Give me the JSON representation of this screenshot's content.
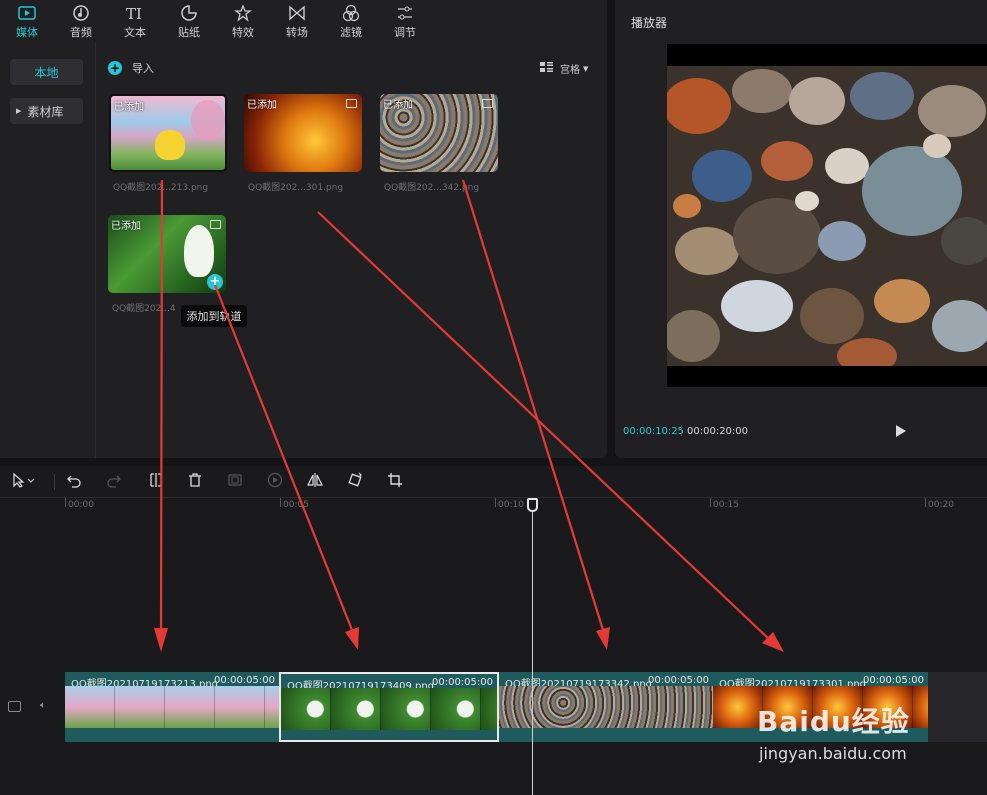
{
  "tabs": [
    {
      "label": "媒体",
      "icon": "media-icon",
      "active": true
    },
    {
      "label": "音频",
      "icon": "audio-icon"
    },
    {
      "label": "文本",
      "icon": "text-icon"
    },
    {
      "label": "贴纸",
      "icon": "sticker-icon"
    },
    {
      "label": "特效",
      "icon": "effects-icon"
    },
    {
      "label": "转场",
      "icon": "transition-icon"
    },
    {
      "label": "滤镜",
      "icon": "filter-icon"
    },
    {
      "label": "调节",
      "icon": "adjust-icon"
    }
  ],
  "sidebar": {
    "local": "本地",
    "library": "素材库"
  },
  "media": {
    "import_label": "导入",
    "view_label": "宫格",
    "items": [
      {
        "badge": "已添加",
        "caption": "QQ截图202...213.png"
      },
      {
        "badge": "已添加",
        "caption": "QQ截图202...301.png"
      },
      {
        "badge": "已添加",
        "caption": "QQ截图202...342.png"
      },
      {
        "badge": "已添加",
        "caption": "QQ截图202...4"
      }
    ],
    "tooltip": "添加到轨道"
  },
  "player": {
    "title": "播放器",
    "time_current": "00:00:10:25",
    "time_total": "00:00:20:00"
  },
  "ruler": [
    "00:00",
    "00:05",
    "00:10",
    "00:15",
    "00:20"
  ],
  "clips": [
    {
      "name": "QQ截图20210719173213.png",
      "duration": "00:00:05:00"
    },
    {
      "name": "QQ截图20210719173409.png",
      "duration": "00:00:05:00"
    },
    {
      "name": "QQ截图20210719173342.png",
      "duration": "00:00:05:00"
    },
    {
      "name": "QQ截图20210719173301.png",
      "duration": "00:00:05:00"
    }
  ],
  "watermark": {
    "brand": "Baidu经验",
    "url": "jingyan.baidu.com"
  },
  "colors": {
    "accent": "#27c6d6",
    "clip": "#1f5b5c",
    "arrow": "#e53935"
  }
}
